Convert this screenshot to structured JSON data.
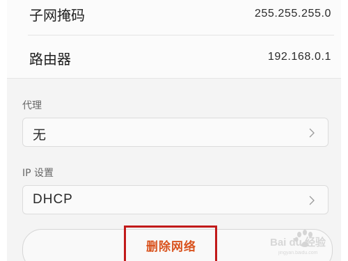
{
  "network_info": {
    "rows": [
      {
        "label": "子网掩码",
        "value": "255.255.255.0"
      },
      {
        "label": "路由器",
        "value": "192.168.0.1"
      }
    ]
  },
  "proxy": {
    "label": "代理",
    "value": "无",
    "chevron_icon": "chevron-right-icon"
  },
  "ip_settings": {
    "label": "IP 设置",
    "value": "DHCP",
    "chevron_icon": "chevron-right-icon"
  },
  "delete_button": {
    "label": "删除网络",
    "color": "#d9531e",
    "highlight_color": "#c11a1a"
  },
  "watermark": {
    "text": "Bai du 经验",
    "subtext": "jingyan.baidu.com",
    "icon": "baidu-paw-icon"
  }
}
